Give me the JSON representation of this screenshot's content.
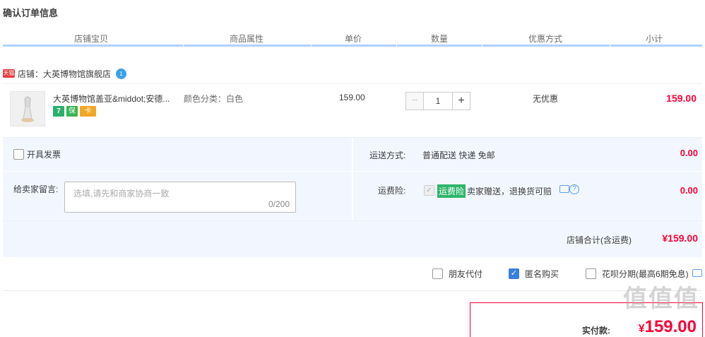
{
  "page_title": "确认订单信息",
  "columns": [
    "店铺宝贝",
    "商品属性",
    "单价",
    "数量",
    "优惠方式",
    "小计"
  ],
  "shop": {
    "tmall_label": "天猫",
    "name": "店铺：大英博物馆旗舰店",
    "ww_label": "1"
  },
  "item": {
    "title": "大英博物馆盖亚&middot;安德...",
    "badges": [
      "7",
      "保",
      "卡"
    ],
    "attribute": "颜色分类：白色",
    "price": "159.00",
    "quantity": "1",
    "minus": "−",
    "plus": "+",
    "discount": "无优惠",
    "subtotal": "159.00"
  },
  "invoice": {
    "label": "开具发票"
  },
  "shipping": {
    "label": "运送方式:",
    "value": "普通配送 快递 免邮",
    "fee": "0.00"
  },
  "message": {
    "label": "给卖家留言:",
    "placeholder": "选填,请先和商家协商一致",
    "counter": "0/200"
  },
  "insurance": {
    "label": "运费险:",
    "check": "✓",
    "tag": "运费险",
    "desc": "卖家赠送，退换货可赔",
    "q": "?",
    "fee": "0.00"
  },
  "shop_total": {
    "label": "店铺合计(含运费)",
    "value": "¥159.00"
  },
  "options": {
    "friend_pay": "朋友代付",
    "anonymous": "匿名购买",
    "anonymous_check": "✓",
    "huabei": "花呗分期(最高6期免息)"
  },
  "payment": {
    "label": "实付款:",
    "currency": "¥",
    "amount": "159.00"
  },
  "watermark": "值值值"
}
